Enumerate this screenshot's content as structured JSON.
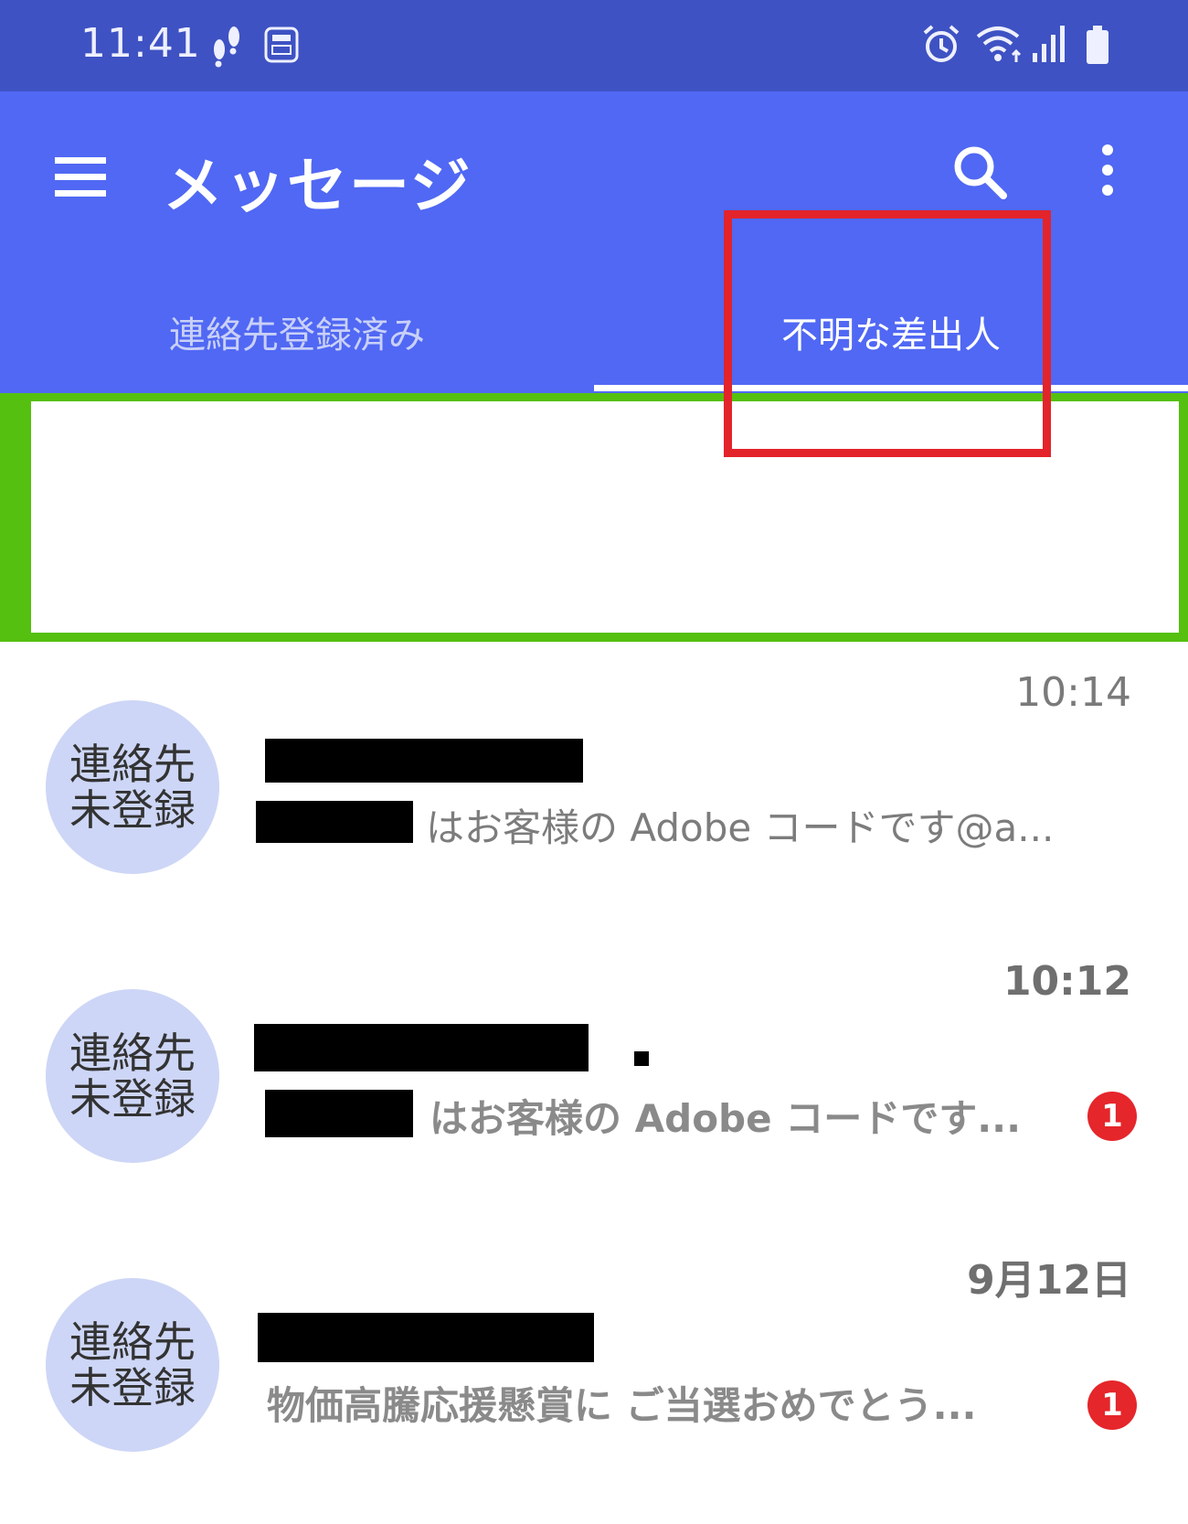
{
  "status_bar": {
    "time": "11:41",
    "left_icons": [
      "footsteps-icon",
      "pay-app-icon"
    ],
    "right_icons": [
      "alarm-icon",
      "wifi-icon",
      "signal-icon",
      "battery-icon"
    ]
  },
  "app_bar": {
    "title": "メッセージ",
    "actions": [
      "search-icon",
      "more-vert-icon"
    ]
  },
  "tabs": [
    {
      "label": "連絡先登録済み",
      "selected": false
    },
    {
      "label": "不明な差出人",
      "selected": true
    }
  ],
  "highlights": {
    "red_box_color": "#e3242b",
    "green_box_color": "#55c010"
  },
  "colors": {
    "status_bar": "#3e52c3",
    "app_bar": "#5068f3",
    "avatar": "#cdd6f6",
    "badge": "#e5262b"
  },
  "conversations": [
    {
      "avatar_line1": "連絡先",
      "avatar_line2": "未登録",
      "time": "10:14",
      "preview": "はお客様の Adobe コードです@a...",
      "unread": false
    },
    {
      "avatar_line1": "連絡先",
      "avatar_line2": "未登録",
      "time": "10:12",
      "preview": "はお客様の Adobe コードです...",
      "unread": true,
      "badge": "1"
    },
    {
      "avatar_line1": "連絡先",
      "avatar_line2": "未登録",
      "time": "9月12日",
      "preview": "物価高騰応援懸賞に ご当選おめでとう...",
      "unread": true,
      "badge": "1"
    }
  ]
}
